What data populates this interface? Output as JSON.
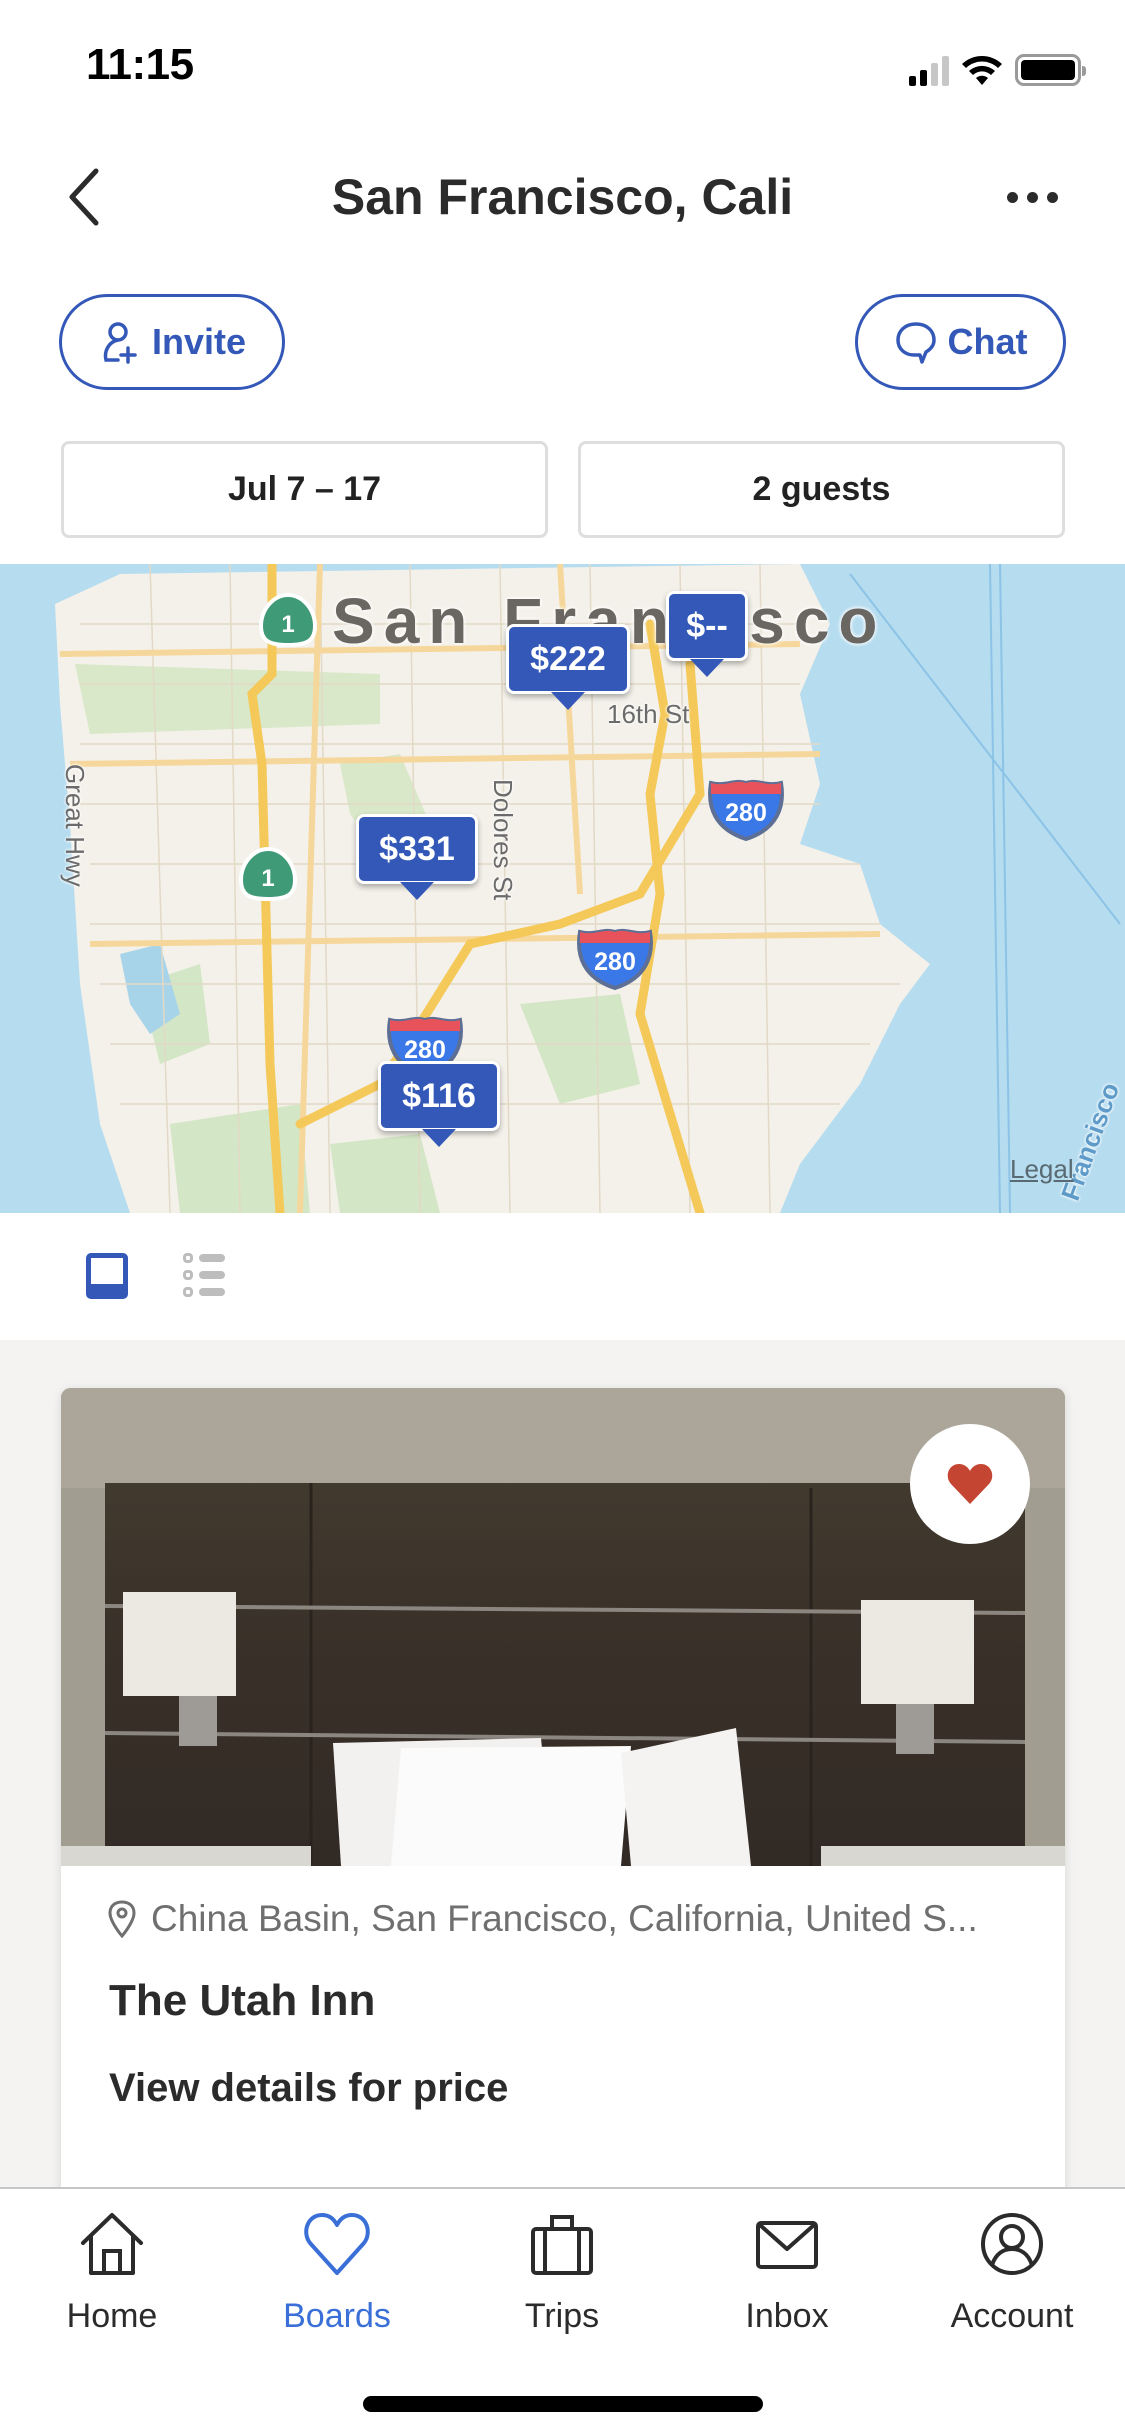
{
  "status_bar": {
    "time": "11:15",
    "signal_bars_active": 2,
    "signal_bars_total": 4,
    "wifi": "wifi-icon",
    "battery": "battery-full-icon"
  },
  "nav": {
    "back_icon": "chevron-left-icon",
    "title": "San Francisco,  Cali",
    "more_icon": "more-horizontal-icon"
  },
  "actions": {
    "invite_label": "Invite",
    "invite_icon": "person-add-icon",
    "chat_label": "Chat",
    "chat_icon": "chat-bubble-icon"
  },
  "filters": {
    "dates": "Jul 7 – 17",
    "guests": "2 guests"
  },
  "map": {
    "city_label": "San Francisco",
    "street_labels": [
      "16th St",
      "Dolores St",
      "Great Hwy"
    ],
    "highway_shields": [
      "1",
      "1",
      "280",
      "280",
      "280"
    ],
    "price_pins": [
      "$222",
      "$--",
      "$331",
      "$116"
    ],
    "legal_link": "Legal",
    "water_label": "Francisco"
  },
  "view_toggle": {
    "options": [
      "grid-view-icon",
      "list-view-icon"
    ],
    "selected": "grid-view-icon"
  },
  "listing": {
    "favorited": true,
    "location_icon": "map-pin-icon",
    "location": "China Basin, San Francisco, California, United S...",
    "name": "The Utah Inn",
    "price_text": "View details for price"
  },
  "tabbar": {
    "active": "Boards",
    "items": [
      {
        "label": "Home",
        "icon": "home-icon"
      },
      {
        "label": "Boards",
        "icon": "heart-icon"
      },
      {
        "label": "Trips",
        "icon": "suitcase-icon"
      },
      {
        "label": "Inbox",
        "icon": "mail-icon"
      },
      {
        "label": "Account",
        "icon": "account-icon"
      }
    ]
  },
  "colors": {
    "brand_blue": "#3358b8",
    "active_tab_blue": "#3a6fd8",
    "heart_red": "#c44532",
    "text_dark": "#2b2b2b"
  }
}
